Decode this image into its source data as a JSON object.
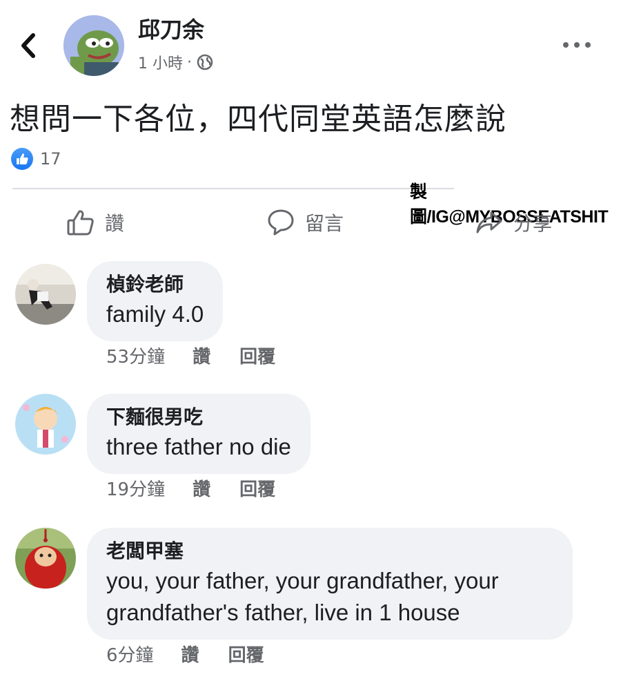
{
  "post": {
    "author": "邱刀余",
    "time": "1 小時",
    "separator": "·",
    "privacy_icon": "globe-icon",
    "text": "想問一下各位，四代同堂英語怎麼說",
    "reaction_count": "17"
  },
  "watermark": "製圖/IG@MYBOSSEATSHIT",
  "actions": {
    "like_label": "讚",
    "comment_label": "留言",
    "share_label": "分享"
  },
  "comments": [
    {
      "name": "楨鈴老師",
      "text": "family 4.0",
      "time": "53分鐘",
      "like_label": "讚",
      "reply_label": "回覆"
    },
    {
      "name": "下麵很男吃",
      "text": "three father no die",
      "time": "19分鐘",
      "like_label": "讚",
      "reply_label": "回覆"
    },
    {
      "name": "老闆甲塞",
      "text": "you, your father, your grandfather, your grandfather's father, live in 1 house",
      "time": "6分鐘",
      "like_label": "讚",
      "reply_label": "回覆"
    }
  ],
  "colors": {
    "accent": "#1877f2",
    "bubble": "#f0f2f5",
    "secondary_text": "#65676b"
  }
}
